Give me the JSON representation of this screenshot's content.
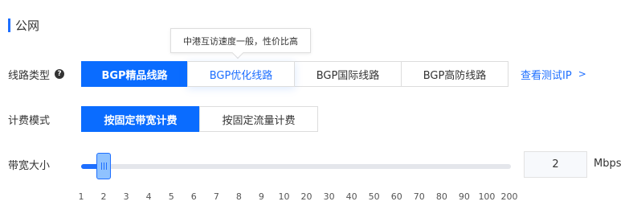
{
  "section": {
    "title": "公网"
  },
  "tooltip": {
    "text": "中港互访速度一般，性价比高"
  },
  "line_type": {
    "label": "线路类型",
    "help_icon": "question-circle-icon",
    "options": [
      "BGP精品线路",
      "BGP优化线路",
      "BGP国际线路",
      "BGP高防线路"
    ],
    "selected": "BGP精品线路",
    "hovered": "BGP优化线路",
    "test_link": "查看测试IP",
    "test_link_icon": "chevron-right-icon"
  },
  "billing": {
    "label": "计费模式",
    "options": [
      "按固定带宽计费",
      "按固定流量计费"
    ],
    "selected": "按固定带宽计费"
  },
  "bandwidth": {
    "label": "带宽大小",
    "value": "2",
    "unit": "Mbps",
    "ticks": [
      "1",
      "2",
      "3",
      "4",
      "5",
      "6",
      "7",
      "8",
      "9",
      "10",
      "20",
      "30",
      "40",
      "50",
      "60",
      "70",
      "80",
      "90",
      "100",
      "200"
    ]
  },
  "colors": {
    "accent": "#0a6cff",
    "handle": "#8fc2ff",
    "track": "#e4e6eb"
  }
}
